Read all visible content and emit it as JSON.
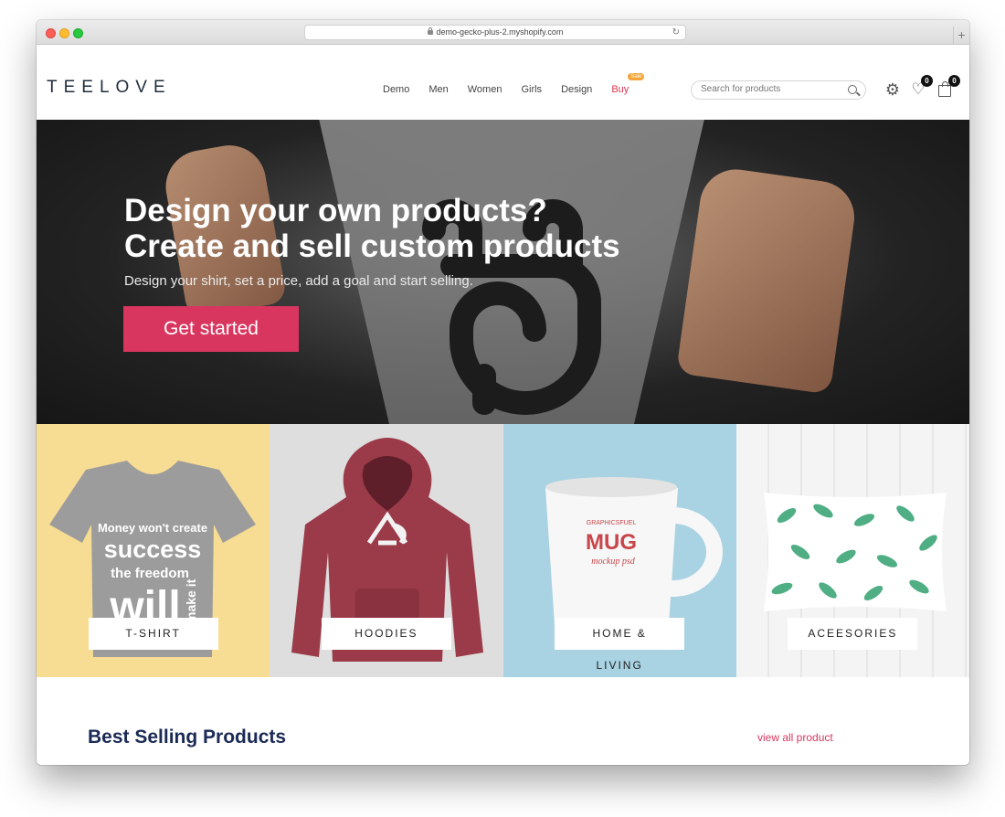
{
  "browser": {
    "url": "demo-gecko-plus-2.myshopify.com"
  },
  "header": {
    "logo": "TEELOVE",
    "nav": [
      {
        "label": "Demo"
      },
      {
        "label": "Men"
      },
      {
        "label": "Women"
      },
      {
        "label": "Girls"
      },
      {
        "label": "Design"
      },
      {
        "label": "Buy",
        "badge": "Sale"
      }
    ],
    "search_placeholder": "Search for products",
    "wishlist_count": "0",
    "cart_count": "0",
    "icons": [
      "settings-gear-icon",
      "heart-icon",
      "shopping-bag-icon",
      "search-icon"
    ]
  },
  "hero": {
    "title_line1": "Design your own products?",
    "title_line2": "Create and sell custom products",
    "subtitle": "Design your shirt, set a price, add a goal and start selling.",
    "cta": "Get started"
  },
  "categories": [
    {
      "label": "T-SHIRT",
      "tee_text": [
        "Money won't create",
        "success",
        "the freedom",
        "will",
        "make it"
      ]
    },
    {
      "label": "HOODIES"
    },
    {
      "label": "HOME & LIVING",
      "mug_text": [
        "GRAPHICSFUEL",
        "MUG",
        "mockup psd"
      ]
    },
    {
      "label": "ACEESORIES"
    }
  ],
  "best_selling": {
    "title": "Best Selling Products",
    "view_all": "view all product"
  },
  "colors": {
    "accent": "#d8365f",
    "sale_badge": "#f3a53a",
    "heading": "#1b2a55"
  }
}
